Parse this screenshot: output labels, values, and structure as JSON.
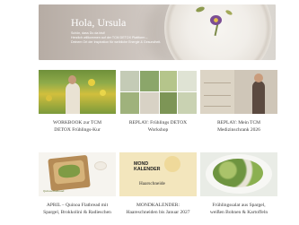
{
  "hero": {
    "greeting": "Hola, Ursula",
    "sub_line1": "Schön, dass Du da bist!",
    "sub_line2": "Herzlich willkommen auf der TCM DETOX Plattform –",
    "sub_line3": "Deinem Ort der Inspiration für weibliche Energie & Gesundheit."
  },
  "cards": [
    {
      "title_line1": "WORKBOOK zur TCM",
      "title_line2": "DETOX Frühlings-Kur"
    },
    {
      "title_line1": "REPLAY: Frühlings DETOX",
      "title_line2": "Workshop"
    },
    {
      "title_line1": "REPLAY: Mein TCM",
      "title_line2": "Medizinschrank 2026"
    },
    {
      "title_line1": "APRIL – Quinoa Flatbread mit",
      "title_line2": "Spargel, Brokkolini & Radieschen",
      "thumb_tag": "Quinoa-Flatbread"
    },
    {
      "title_line1": "MONDKALENDER:",
      "title_line2": "Haareschneiden bis Januar 2027",
      "thumb_line1": "MOND",
      "thumb_line2": "KALENDER",
      "thumb_line3": "Haarschneide"
    },
    {
      "title_line1": "Frühlingssalat aus Spargel,",
      "title_line2": "weißen Bohnen & Kartoffeln"
    }
  ]
}
